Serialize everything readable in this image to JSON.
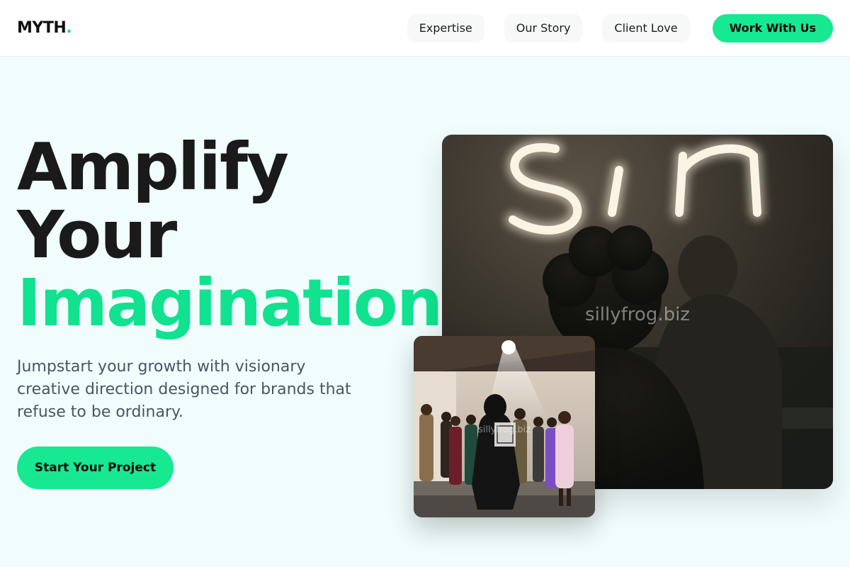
{
  "nav": {
    "logo_text": "MYTH",
    "logo_dot": ".",
    "links": [
      "Expertise",
      "Our Story",
      "Client Love"
    ],
    "cta_label": "Work With Us"
  },
  "hero": {
    "headline_line1": "Amplify",
    "headline_line2": "Your",
    "headline_line3": "Imagination.",
    "subtext": "Jumpstart your growth with visionary creative direction designed for brands that refuse to be ordinary.",
    "cta_label": "Start Your Project"
  },
  "images": {
    "main_watermark": "sillyfrog.biz",
    "small_watermark": "sillyfrog.biz"
  },
  "colors": {
    "accent": "#10e28f",
    "button": "#17e892",
    "background": "#f0fdfc",
    "text_dark": "#1a1a1a",
    "text_muted": "#4b5563"
  }
}
